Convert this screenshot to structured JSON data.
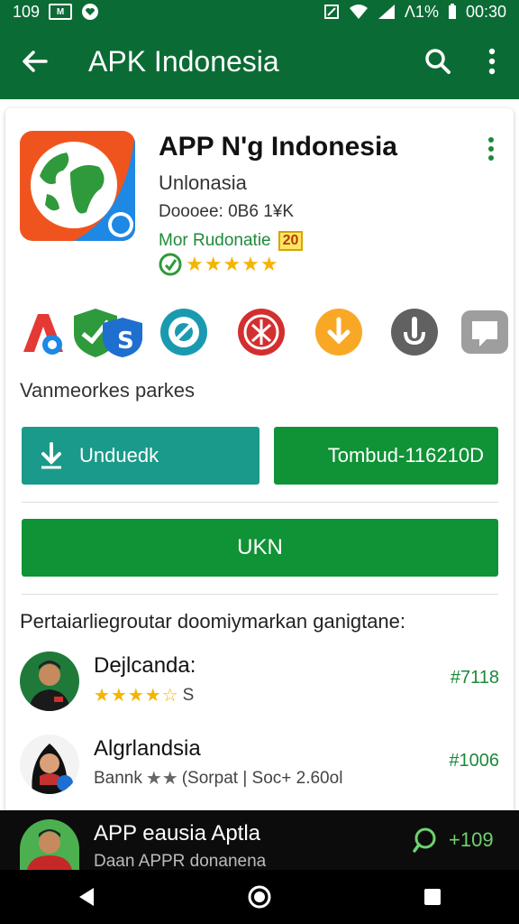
{
  "status_bar": {
    "time_left": "109",
    "battery_text": "Λ1%",
    "clock": "00:30"
  },
  "app_bar": {
    "title": "APK Indonesia"
  },
  "app": {
    "name": "APP N'g Indonesia",
    "developer": "Unlonasia",
    "downloads": "Doooee: 0B6 1¥K",
    "rating_label": "Mor Rudonatie",
    "age_badge": "20",
    "stars": "★★★★★"
  },
  "icons": [
    "a-icon",
    "shield-check-icon",
    "globe-arrows-icon",
    "seal-icon",
    "download-circle-icon",
    "mic-icon",
    "chat-square-icon"
  ],
  "caption": "Vanmeorkes parkes",
  "buttons": {
    "install_label": "Unduedk",
    "price_label": "Tombud-116210D",
    "wide_label": "UKN"
  },
  "reviews": {
    "section_title": "Pertaiarliegroutar doomiymarkan ganigtane:",
    "items": [
      {
        "name": "Dejlcanda:",
        "stars": "★★★★☆",
        "sub": "S",
        "value": "#7118"
      },
      {
        "name": "Algrlandsia",
        "stars": "★★",
        "sub_prefix": "Bannk",
        "sub": "(Sorpat | Soc+ 2.60ol",
        "value": "#1006"
      }
    ]
  },
  "bottom_bar": {
    "title": "APP eausia Aptla",
    "subtitle": "Daan APPR donanena",
    "count": "+109"
  },
  "colors": {
    "primary": "#0b6b35",
    "button_green": "#109236",
    "button_teal": "#1a9a8a",
    "star": "#f4b400"
  }
}
